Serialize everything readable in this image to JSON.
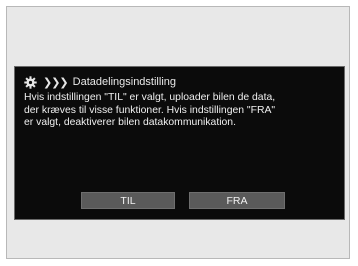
{
  "dialog": {
    "header": {
      "icon": "gear-icon",
      "chevrons": "❯❯❯",
      "title": "Datadelingsindstilling"
    },
    "message_lines": [
      "Hvis indstillingen \"TIL\" er valgt, uploader bilen de data,",
      "der kræves til visse funktioner. Hvis indstillingen \"FRA\"",
      "er valgt, deaktiverer bilen datakommunikation."
    ],
    "buttons": {
      "on_label": "TIL",
      "off_label": "FRA"
    }
  },
  "colors": {
    "dialog_background": "#0b0b0b",
    "button_background": "#5a5a5a",
    "frame_background": "#e8e8e8"
  }
}
